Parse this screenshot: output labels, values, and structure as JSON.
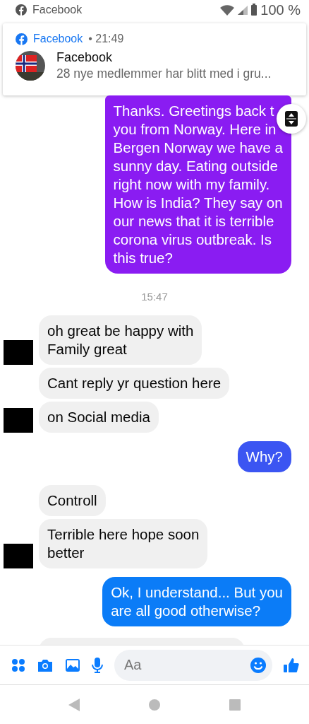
{
  "status_bar": {
    "app": "Facebook",
    "battery": "100 %"
  },
  "notification": {
    "app": "Facebook",
    "time": "• 21:49",
    "title": "Facebook",
    "text": "28 nye medlemmer har blitt med i gru..."
  },
  "messages": [
    {
      "kind": "out",
      "color": "#8a1cf2",
      "lines": [
        "Thanks. Greetings back t",
        "you from Norway. Here in",
        "Bergen Norway we have a",
        "sunny day. Eating outside",
        "right now with my family.",
        "How is India? They say on",
        "our news that it is terrible",
        "corona virus outbreak. Is",
        "this true?"
      ]
    },
    {
      "kind": "time",
      "text": "15:47"
    },
    {
      "kind": "in",
      "avatar": true,
      "lines": [
        "oh  great be  happy with",
        "Family great"
      ]
    },
    {
      "kind": "in",
      "avatar": false,
      "lines": [
        "Cant reply yr question here"
      ]
    },
    {
      "kind": "in",
      "avatar": true,
      "lines": [
        "on Social media"
      ]
    },
    {
      "kind": "out",
      "color": "#3b55f2",
      "lines": [
        "Why?"
      ]
    },
    {
      "kind": "in",
      "avatar": false,
      "lines": [
        "Controll"
      ]
    },
    {
      "kind": "in",
      "avatar": true,
      "lines": [
        "Terrible here  hope soon",
        "better"
      ]
    },
    {
      "kind": "out",
      "color": "#0b7cf7",
      "lines": [
        "Ok, I understand... But you",
        "are all good otherwise?"
      ]
    },
    {
      "kind": "partial"
    }
  ],
  "composer": {
    "placeholder": "Aa"
  }
}
